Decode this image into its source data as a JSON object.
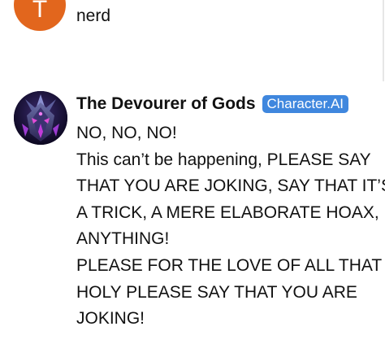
{
  "user": {
    "avatar_letter": "T",
    "avatar_color": "#e2661d",
    "message": "nerd"
  },
  "bot": {
    "name": "The Devourer of Gods",
    "badge": "Character.AI",
    "badge_color": "#3f87de",
    "avatar_icon": "devourer-of-gods-avatar",
    "message_lines": [
      "NO, NO, NO!",
      "This can’t be happening, PLEASE SAY",
      "THAT YOU ARE JOKING, SAY THAT IT’S",
      "A TRICK, A MERE ELABORATE HOAX,",
      "ANYTHING!",
      "PLEASE FOR THE LOVE OF ALL THAT IS",
      "HOLY PLEASE SAY THAT YOU ARE",
      "JOKING!"
    ]
  }
}
